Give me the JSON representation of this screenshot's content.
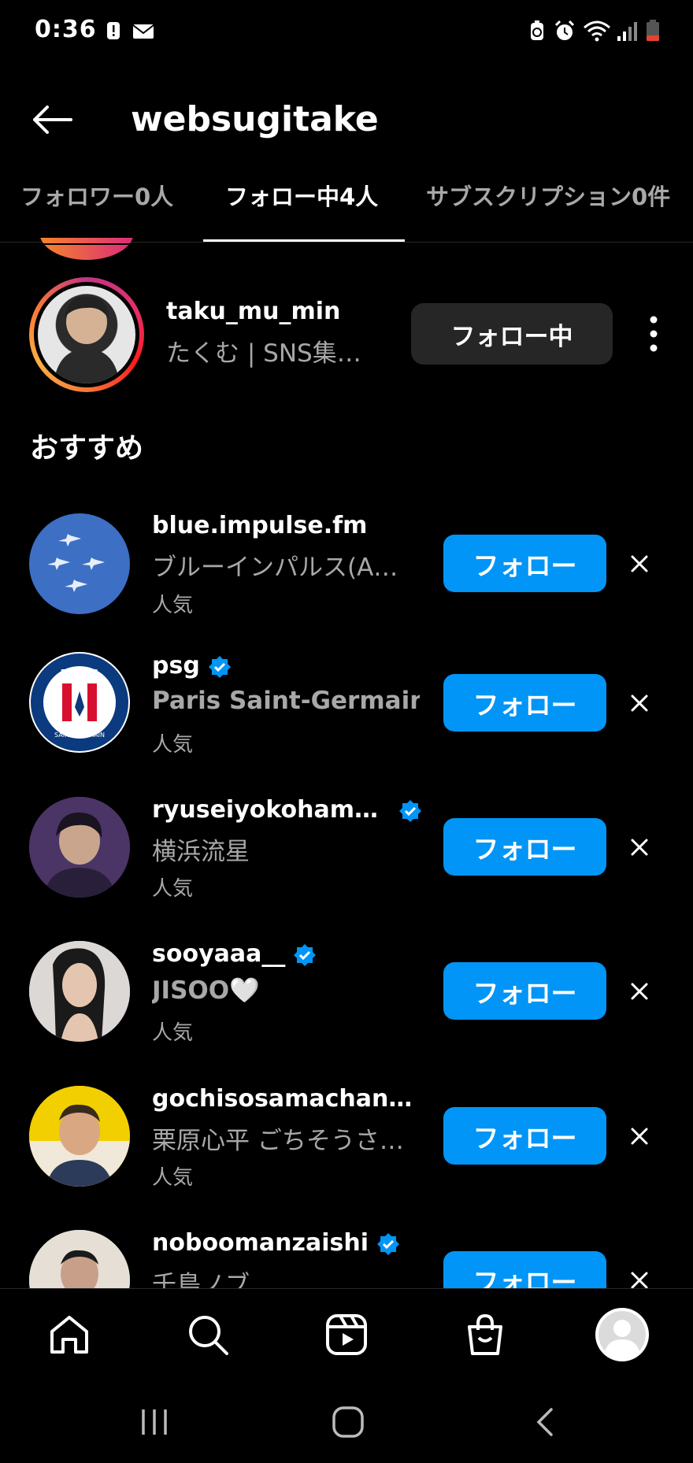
{
  "status_bar": {
    "time": "0:36",
    "icons": [
      "alert-icon",
      "mail-icon",
      "battery-saver-icon",
      "alarm-icon",
      "wifi-icon",
      "signal-icon",
      "battery-low-icon"
    ]
  },
  "header": {
    "title": "websugitake",
    "back_icon": "arrow-left-icon"
  },
  "tabs": [
    {
      "label": "フォロワー0人",
      "active": false
    },
    {
      "label": "フォロー中4人",
      "active": true
    },
    {
      "label": "サブスクリプション0件",
      "active": false
    }
  ],
  "following": [
    {
      "username": "taku_mu_min",
      "display_name": "たくむ | SNS集…",
      "button_label": "フォロー中"
    }
  ],
  "suggested": {
    "title": "おすすめ",
    "items": [
      {
        "username": "blue.impulse.fm",
        "display_name": "ブルーインパルス(A…",
        "sub": "人気",
        "verified": false,
        "button_label": "フォロー"
      },
      {
        "username": "psg",
        "display_name": "Paris Saint-Germain",
        "sub": "人気",
        "verified": true,
        "button_label": "フォロー",
        "logo_text": "PARIS",
        "logo_bottom": "SAINT-GERMAIN"
      },
      {
        "username": "ryuseiyokoham…",
        "display_name": "横浜流星",
        "sub": "人気",
        "verified": true,
        "button_label": "フォロー"
      },
      {
        "username": "sooyaaa__",
        "display_name": "JISOO🤍",
        "sub": "人気",
        "verified": true,
        "button_label": "フォロー"
      },
      {
        "username": "gochisosamachan…",
        "display_name": "栗原心平 ごちそうさ…",
        "sub": "人気",
        "verified": false,
        "button_label": "フォロー"
      },
      {
        "username": "noboomanzaishi",
        "display_name": "千鳥ノブ",
        "sub": "",
        "verified": true,
        "button_label": "フォロー"
      }
    ]
  },
  "bottom_nav": [
    "home-icon",
    "search-icon",
    "reels-icon",
    "shop-icon",
    "profile-avatar"
  ],
  "system_nav": [
    "recent-apps-icon",
    "home-circle-icon",
    "back-chevron-icon"
  ],
  "colors": {
    "background": "#000000",
    "follow_button": "#0095f6",
    "following_button": "#262626",
    "secondary_text": "#a8a8a8",
    "verified_badge": "#0095f6"
  }
}
